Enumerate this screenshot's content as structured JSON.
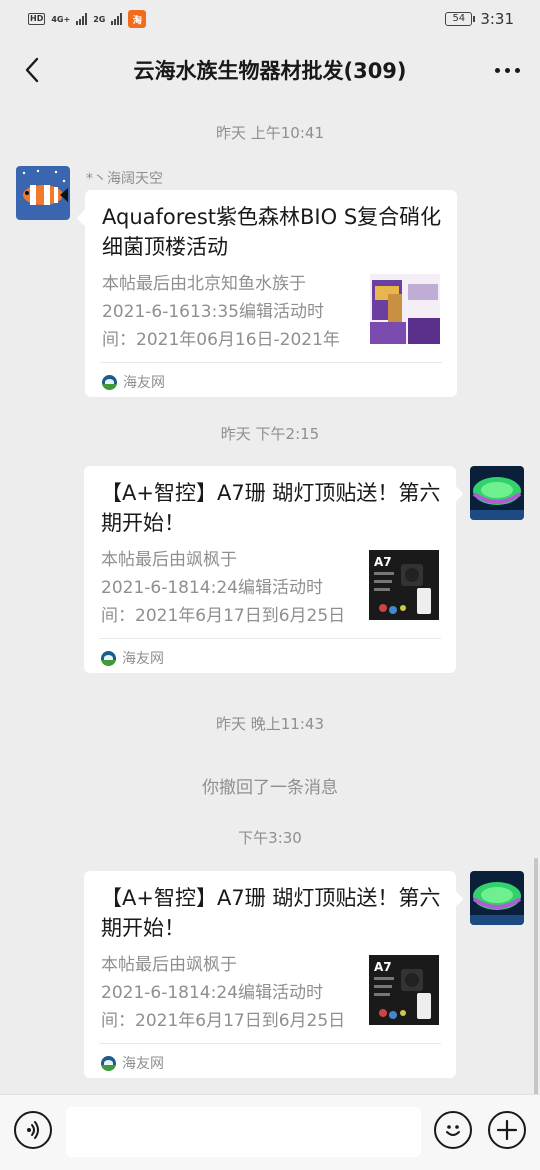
{
  "status_bar": {
    "hd": "HD",
    "net1": "4G+",
    "net2": "2G",
    "app_badge": "淘",
    "battery": "54",
    "time": "3:31"
  },
  "nav": {
    "title": "云海水族生物器材批发(309)",
    "back_icon": "chevron-left-icon",
    "more_icon": "more-dots-icon"
  },
  "messages": [
    {
      "type": "timestamp",
      "text": "昨天 上午10:41"
    },
    {
      "type": "card",
      "side": "left",
      "sender": "*丶海阔天空",
      "title": "Aquaforest紫色森林BIO S复合硝化细菌顶楼活动",
      "desc_lines": [
        "本帖最后由北京知鱼水族于",
        "2021-6-1613:35编辑活动时",
        "间：2021年06月16日-2021年"
      ],
      "source": "海友网"
    },
    {
      "type": "timestamp",
      "text": "昨天 下午2:15"
    },
    {
      "type": "card",
      "side": "right",
      "title": "【A+智控】A7珊 瑚灯顶贴送！第六期开始！",
      "desc_lines": [
        "本帖最后由飒枫于",
        "2021-6-1814:24编辑活动时",
        "间：2021年6月17日到6月25日"
      ],
      "thumb_label": "A7",
      "source": "海友网"
    },
    {
      "type": "timestamp",
      "text": "昨天 晚上11:43"
    },
    {
      "type": "recall",
      "text": "你撤回了一条消息"
    },
    {
      "type": "timestamp",
      "text": "下午3:30"
    },
    {
      "type": "card",
      "side": "right",
      "title": "【A+智控】A7珊 瑚灯顶贴送！第六期开始！",
      "desc_lines": [
        "本帖最后由飒枫于",
        "2021-6-1814:24编辑活动时",
        "间：2021年6月17日到6月25日"
      ],
      "thumb_label": "A7",
      "source": "海友网"
    }
  ],
  "input_bar": {
    "voice_icon": "voice-icon",
    "emoji_icon": "emoji-icon",
    "plus_icon": "plus-icon",
    "placeholder": ""
  }
}
